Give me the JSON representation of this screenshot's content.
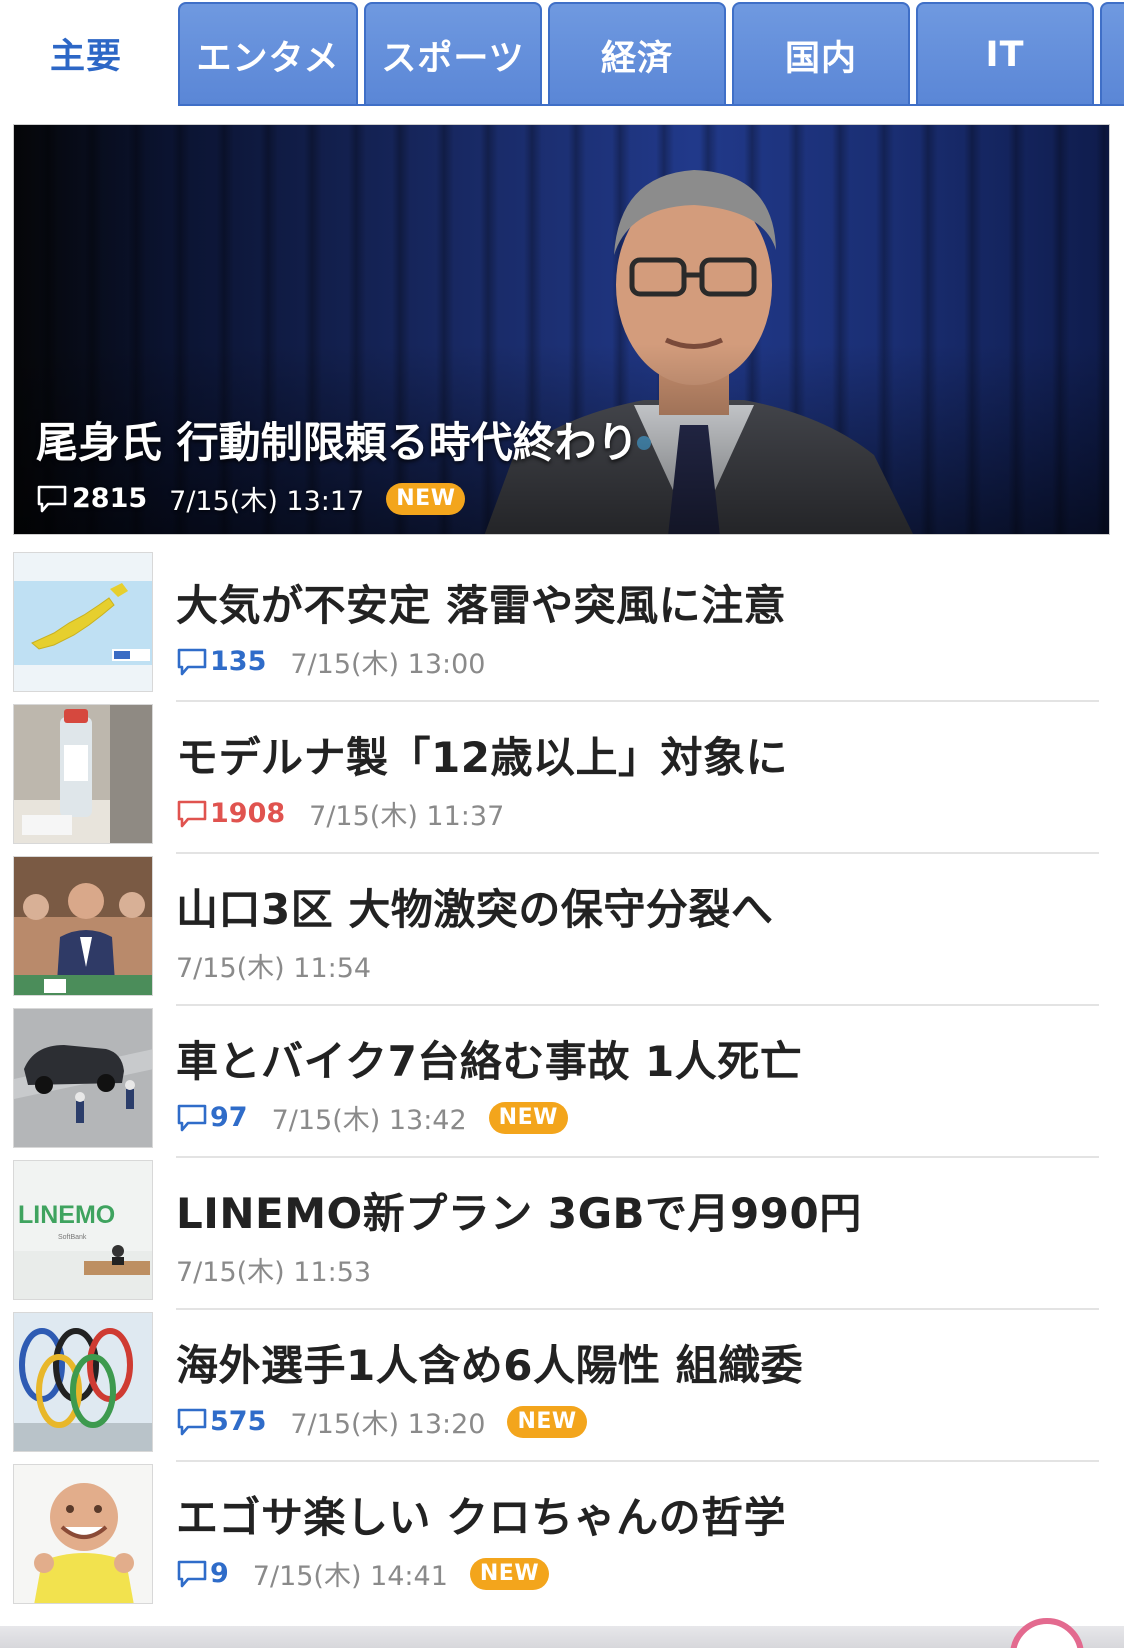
{
  "tabs": [
    {
      "label": "主要",
      "active": true
    },
    {
      "label": "エンタメ",
      "active": false
    },
    {
      "label": "スポーツ",
      "active": false
    },
    {
      "label": "経済",
      "active": false
    },
    {
      "label": "国内",
      "active": false
    },
    {
      "label": "IT",
      "active": false
    }
  ],
  "hero": {
    "title": "尾身氏 行動制限頼る時代終わり",
    "comments": "2815",
    "timestamp": "7/15(木) 13:17",
    "badge": "NEW"
  },
  "articles": [
    {
      "title": "大気が不安定 落雷や突風に注意",
      "comments": "135",
      "comment_color": "blue",
      "timestamp": "7/15(木) 13:00",
      "badge": ""
    },
    {
      "title": "モデルナ製「12歳以上」対象に",
      "comments": "1908",
      "comment_color": "red",
      "timestamp": "7/15(木) 11:37",
      "badge": ""
    },
    {
      "title": "山口3区 大物激突の保守分裂へ",
      "comments": "",
      "comment_color": "",
      "timestamp": "7/15(木) 11:54",
      "badge": ""
    },
    {
      "title": "車とバイク7台絡む事故 1人死亡",
      "comments": "97",
      "comment_color": "blue",
      "timestamp": "7/15(木) 13:42",
      "badge": "NEW"
    },
    {
      "title": "LINEMO新プラン 3GBで月990円",
      "comments": "",
      "comment_color": "",
      "timestamp": "7/15(木) 11:53",
      "badge": ""
    },
    {
      "title": "海外選手1人含め6人陽性 組織委",
      "comments": "575",
      "comment_color": "blue",
      "timestamp": "7/15(木) 13:20",
      "badge": "NEW"
    },
    {
      "title": "エゴサ楽しい クロちゃんの哲学",
      "comments": "9",
      "comment_color": "blue",
      "timestamp": "7/15(木) 14:41",
      "badge": "NEW"
    }
  ],
  "thumb_text": {
    "linemo": "LINEMO",
    "softbank": "SoftBank"
  },
  "colors": {
    "tab_blue": "#5a86d6",
    "active_tab_text": "#2d67c6",
    "comment_blue": "#2f6cc9",
    "comment_red": "#e0534f",
    "new_badge": "#f3a51c"
  },
  "icons": [
    "comment-icon"
  ]
}
